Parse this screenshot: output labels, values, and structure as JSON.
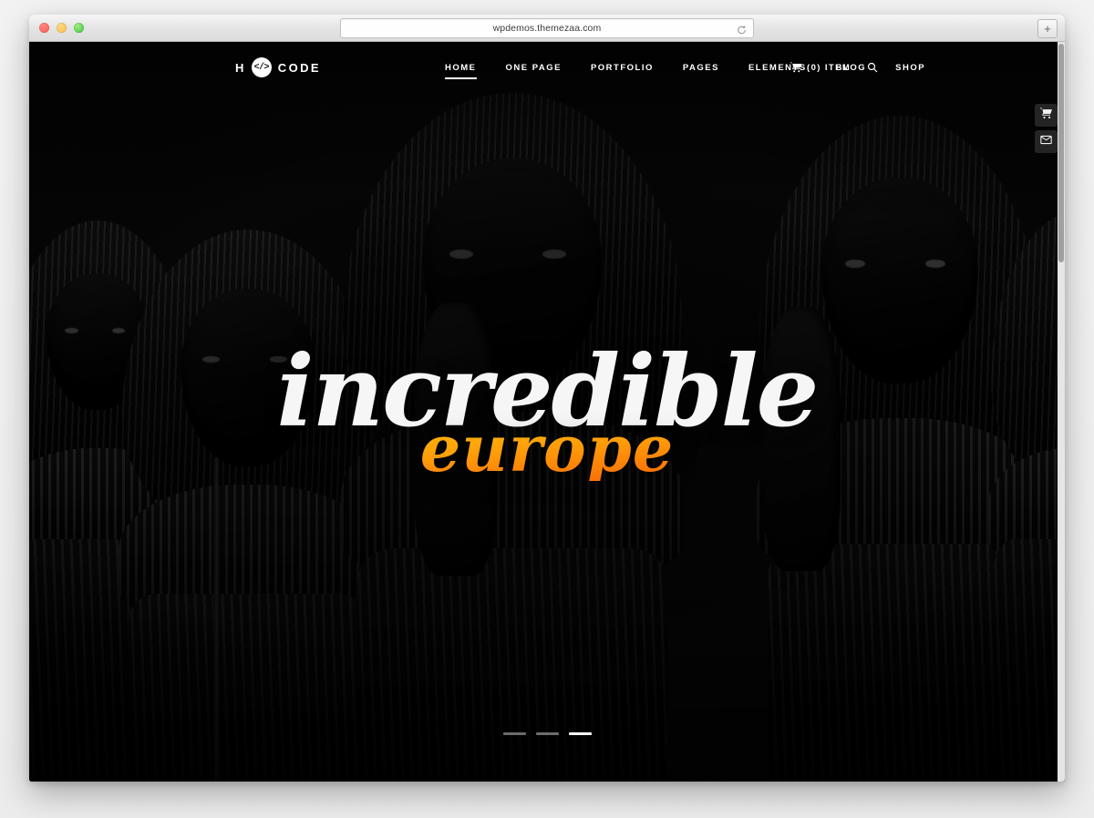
{
  "browser": {
    "url": "wpdemos.themezaa.com",
    "reload_icon": "reload-icon",
    "new_tab_label": "+",
    "traffic_lights": [
      "close",
      "minimize",
      "maximize"
    ]
  },
  "site": {
    "logo": {
      "prefix": "H",
      "badge": "</>",
      "suffix": "CODE"
    },
    "nav": [
      {
        "label": "HOME",
        "active": true
      },
      {
        "label": "ONE PAGE",
        "active": false
      },
      {
        "label": "PORTFOLIO",
        "active": false
      },
      {
        "label": "PAGES",
        "active": false
      },
      {
        "label": "ELEMENTS",
        "active": false
      },
      {
        "label": "BLOG",
        "active": false
      },
      {
        "label": "SHOP",
        "active": false
      }
    ],
    "header_right": {
      "cart_icon": "shopping-cart-icon",
      "cart_label": "(0) ITEM",
      "search_icon": "search-icon"
    },
    "side_tabs": [
      {
        "icon": "shopping-cart-icon",
        "name": "cart-side-tab"
      },
      {
        "icon": "envelope-icon",
        "name": "contact-side-tab"
      }
    ],
    "hero": {
      "headline": "incredible",
      "accent": "europe",
      "accent_color_start": "#ffd21e",
      "accent_color_end": "#e85d04",
      "headline_color": "#f6f6f6"
    },
    "slider": {
      "slides": [
        {
          "index": 1,
          "active": false
        },
        {
          "index": 2,
          "active": false
        },
        {
          "index": 3,
          "active": true
        }
      ]
    }
  }
}
